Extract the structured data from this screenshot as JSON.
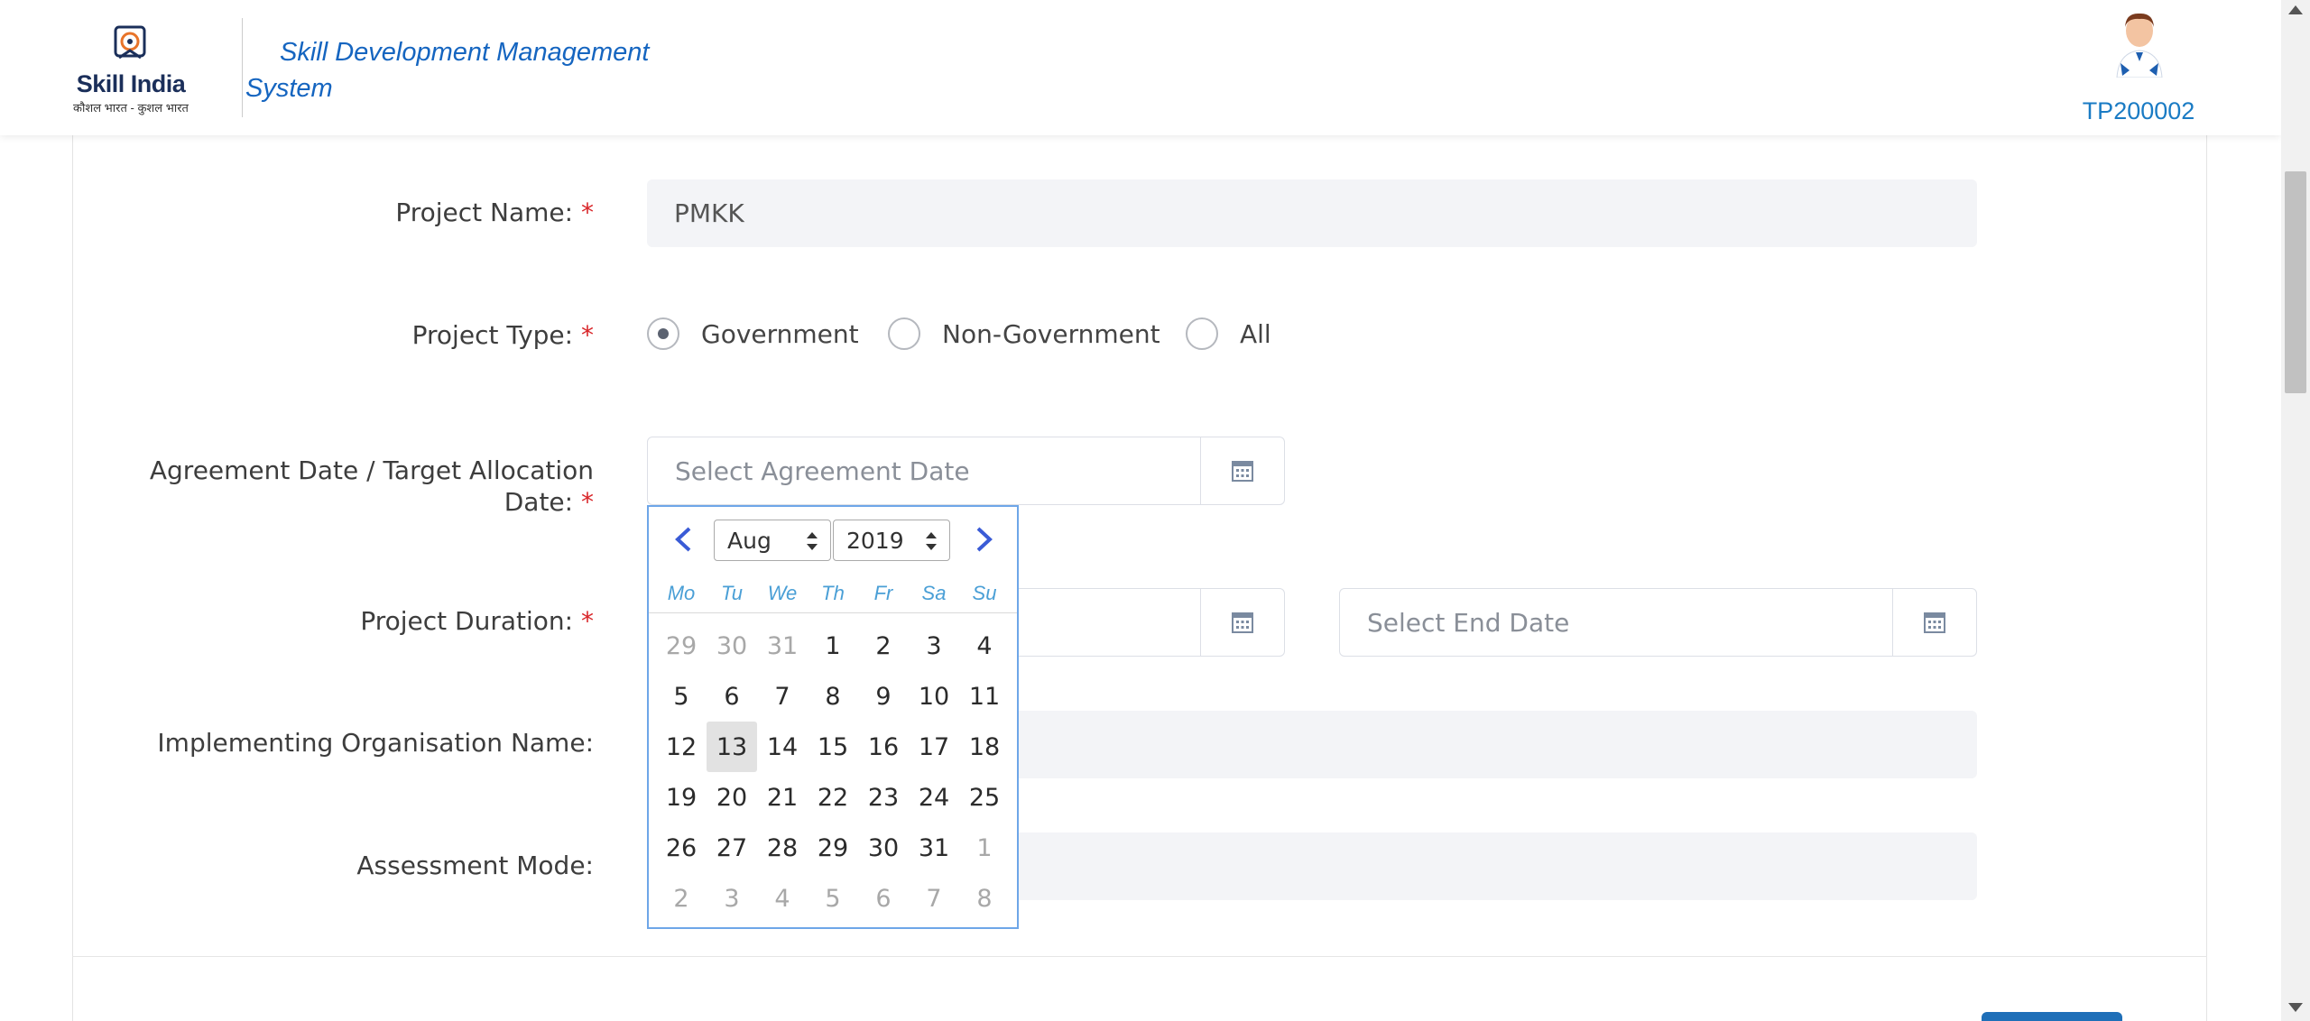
{
  "header": {
    "logo_title": "Skill India",
    "logo_subtitle": "कौशल भारत - कुशल भारत",
    "app_title": "Skill Development Management System",
    "user_id": "TP200002"
  },
  "form": {
    "project_name": {
      "label": "Project Name:",
      "required": "*",
      "value": "PMKK"
    },
    "project_type": {
      "label": "Project Type:",
      "required": "*",
      "options": [
        "Government",
        "Non-Government",
        "All"
      ],
      "selected": "Government"
    },
    "agreement_date": {
      "label_line1": "Agreement Date / Target Allocation",
      "label_line2": "Date:",
      "required": "*",
      "placeholder": "Select Agreement Date"
    },
    "project_duration": {
      "label": "Project Duration:",
      "required": "*",
      "end_placeholder": "Select End Date"
    },
    "implementing_org": {
      "label": "Implementing Organisation Name:"
    },
    "assessment_mode": {
      "label": "Assessment Mode:"
    }
  },
  "datepicker": {
    "month": "Aug",
    "year": "2019",
    "weekdays": [
      "Mo",
      "Tu",
      "We",
      "Th",
      "Fr",
      "Sa",
      "Su"
    ],
    "weeks": [
      [
        "29",
        "30",
        "31",
        "1",
        "2",
        "3",
        "4"
      ],
      [
        "5",
        "6",
        "7",
        "8",
        "9",
        "10",
        "11"
      ],
      [
        "12",
        "13",
        "14",
        "15",
        "16",
        "17",
        "18"
      ],
      [
        "19",
        "20",
        "21",
        "22",
        "23",
        "24",
        "25"
      ],
      [
        "26",
        "27",
        "28",
        "29",
        "30",
        "31",
        "1"
      ],
      [
        "2",
        "3",
        "4",
        "5",
        "6",
        "7",
        "8"
      ]
    ],
    "highlighted_day": "13",
    "colors": {
      "border": "#6ea6e8",
      "weekday": "#4a9fd6",
      "nav_arrow": "#3a5bd6"
    }
  },
  "colors": {
    "accent": "#1565c0",
    "required": "#d9262a",
    "field_bg": "#f3f4f7"
  }
}
